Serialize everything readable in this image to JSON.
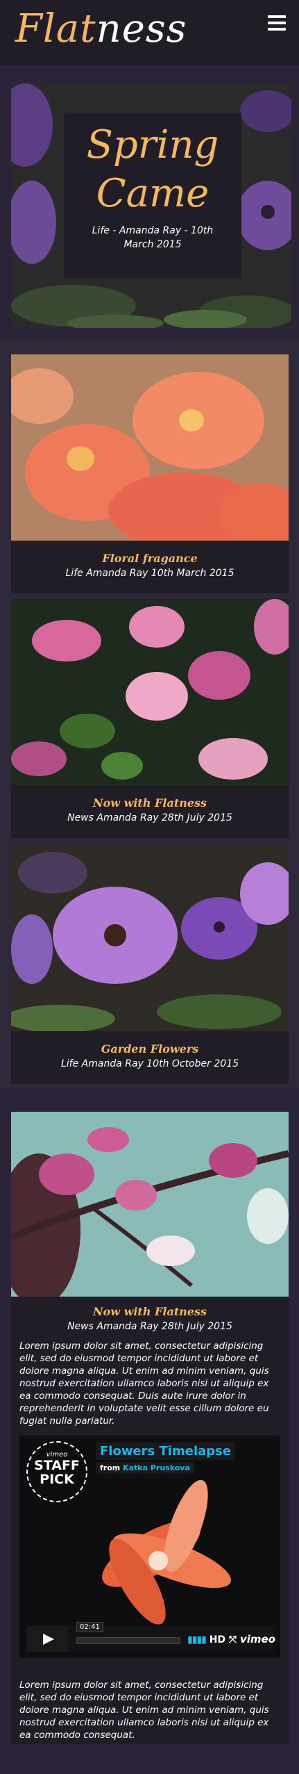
{
  "header": {
    "logo_accent": "Flat",
    "logo_rest": "ness",
    "menu_icon": "hamburger-menu-icon"
  },
  "hero": {
    "title": "Spring Came",
    "meta": "Life - Amanda Ray - 10th March 2015"
  },
  "cards": [
    {
      "title": "Floral fragance",
      "meta": "Life Amanda Ray 10th March 2015"
    },
    {
      "title": "Now with Flatness",
      "meta": "News Amanda Ray 28th July 2015"
    },
    {
      "title": "Garden Flowers",
      "meta": "Life Amanda Ray 10th October 2015"
    }
  ],
  "post": {
    "title": "Now with Flatness",
    "meta": "News Amanda Ray 28th July 2015",
    "paragraph1": "Lorem ipsum dolor sit amet, consectetur adipisicing elit, sed do eiusmod tempor incididunt ut labore et dolore magna aliqua. Ut enim ad minim veniam, quis nostrud exercitation ullamco laboris nisi ut aliquip ex ea commodo consequat. Duis aute irure dolor in reprehenderit in voluptate velit esse cillum dolore eu fugiat nulla pariatur.",
    "paragraph2": "Lorem ipsum dolor sit amet, consectetur adipisicing elit, sed do eiusmod tempor incididunt ut labore et dolore magna aliqua. Ut enim ad minim veniam, quis nostrud exercitation ullamco laboris nisi ut aliquip ex ea commodo consequat."
  },
  "video": {
    "title": "Flowers Timelapse",
    "by_label": "from",
    "author": "Katka Pruskova",
    "badge_top": "vimeo",
    "badge_line1": "STAFF",
    "badge_line2": "PICK",
    "timecode": "02:41",
    "hd_label": "HD",
    "brand": "vimeo"
  },
  "colors": {
    "accent": "#f4b860",
    "background": "#2b2438",
    "panel": "#2f283a",
    "caption_bg": "#211d27",
    "vimeo_blue": "#1ab7ea"
  }
}
